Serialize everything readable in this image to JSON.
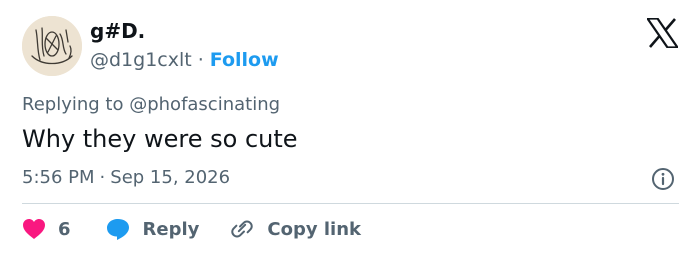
{
  "author": {
    "display_name": "g#D.",
    "handle": "@d1g1cxlt",
    "separator": "·",
    "follow_label": "Follow"
  },
  "reply_context": {
    "prefix": "Replying to",
    "mention": "@phofascinating"
  },
  "tweet": {
    "text": "Why they were so cute",
    "time": "5:56 PM",
    "separator": "·",
    "date": "Sep 15, 2026"
  },
  "actions": {
    "like_count": "6",
    "reply_label": "Reply",
    "copy_link_label": "Copy link"
  },
  "colors": {
    "accent": "#1d9bf0",
    "like": "#f91880",
    "text_primary": "#0f1419",
    "text_secondary": "#536471",
    "divider": "#cfd9de"
  },
  "icons": {
    "logo": "x-logo-icon",
    "info": "info-icon",
    "like": "heart-icon",
    "reply": "speech-bubble-icon",
    "copy": "link-icon"
  }
}
